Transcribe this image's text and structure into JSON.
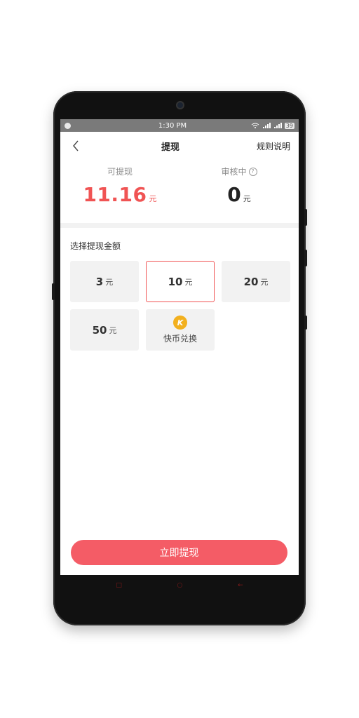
{
  "status_bar": {
    "time": "1:30 PM",
    "battery": "39"
  },
  "header": {
    "title": "提现",
    "rules_link": "规则说明"
  },
  "balance": {
    "available_label": "可提现",
    "available_value": "11.16",
    "available_unit": "元",
    "pending_label": "审核中",
    "pending_value": "0",
    "pending_unit": "元"
  },
  "amount_section": {
    "title": "选择提现金额",
    "options": [
      {
        "value": "3",
        "unit": "元",
        "selected": false
      },
      {
        "value": "10",
        "unit": "元",
        "selected": true
      },
      {
        "value": "20",
        "unit": "元",
        "selected": false
      },
      {
        "value": "50",
        "unit": "元",
        "selected": false
      }
    ],
    "coin_exchange": {
      "icon_letter": "K",
      "label": "快币兑换"
    }
  },
  "withdraw_button": "立即提现",
  "colors": {
    "accent": "#f05454",
    "button": "#f45c66",
    "coin": "#f2b01e"
  }
}
